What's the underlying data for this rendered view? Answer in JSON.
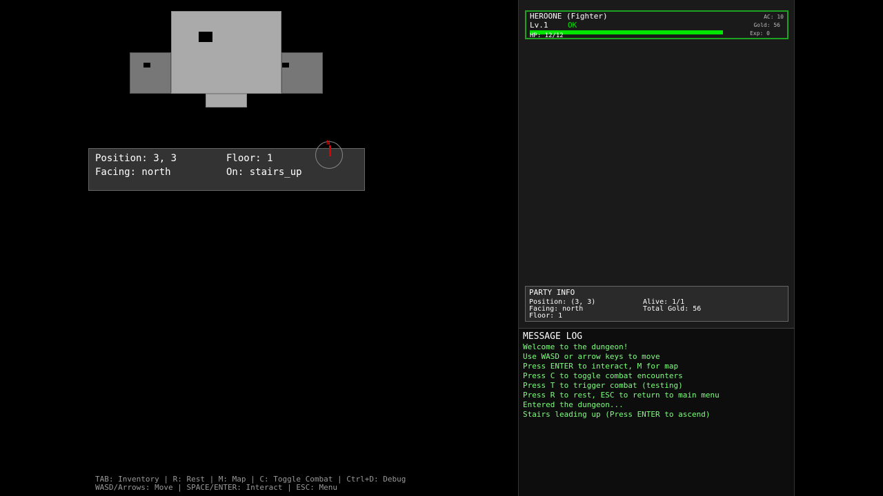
{
  "status": {
    "position": "Position: 3, 3",
    "floor": "Floor: 1",
    "facing": "Facing: north",
    "on": "On: stairs_up"
  },
  "compass": {
    "label": "N"
  },
  "help": {
    "line1": "TAB: Inventory | R: Rest | M: Map | C: Toggle Combat | Ctrl+D: Debug",
    "line2": "WASD/Arrows: Move | SPACE/ENTER: Interact | ESC: Menu"
  },
  "character": {
    "name": "HEROONE (Fighter)",
    "level": "Lv.1",
    "state": "OK",
    "hp_text": "HP: 12/12",
    "hp_fraction": 1.0,
    "ac": "AC: 10",
    "gold": "Gold: 56",
    "exp": "Exp: 0"
  },
  "party": {
    "title": "PARTY INFO",
    "position": "Position: (3, 3)",
    "facing": "Facing: north",
    "floor": "Floor: 1",
    "alive": "Alive: 1/1",
    "total_gold": "Total Gold: 56"
  },
  "log": {
    "title": "MESSAGE LOG",
    "lines": [
      "Welcome to the dungeon!",
      "Use WASD or arrow keys to move",
      "Press ENTER to interact, M for map",
      "Press C to toggle combat encounters",
      "Press T to trigger combat (testing)",
      "Press R to rest, ESC to return to main menu",
      "Entered the dungeon...",
      "Stairs leading up (Press ENTER to ascend)"
    ]
  },
  "colors": {
    "hp_bar": "#00e600",
    "card_border": "#1fa31f",
    "state_ok": "#00e600",
    "log_text": "#7dff7d",
    "compass_needle": "#dd0000"
  }
}
